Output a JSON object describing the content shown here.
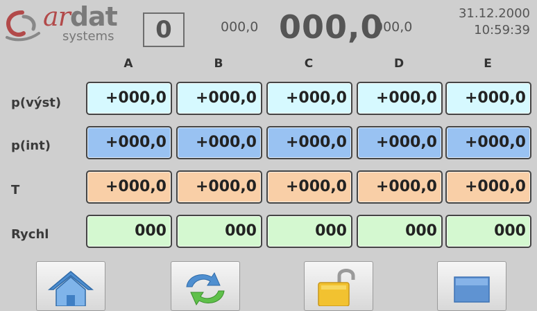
{
  "header": {
    "logo_brand": "ardat",
    "logo_sub": "systems",
    "counter": "0",
    "value_small_left": "000,0",
    "value_big": "000,0",
    "value_small_right": "000,0",
    "date": "31.12.2000",
    "time": "10:59:39"
  },
  "columns": [
    "A",
    "B",
    "C",
    "D",
    "E"
  ],
  "rows": [
    {
      "label": "p(výst)",
      "values": [
        "+000,0",
        "+000,0",
        "+000,0",
        "+000,0",
        "+000,0"
      ]
    },
    {
      "label": "p(int)",
      "values": [
        "+000,0",
        "+000,0",
        "+000,0",
        "+000,0",
        "+000,0"
      ]
    },
    {
      "label": "T",
      "values": [
        "+000,0",
        "+000,0",
        "+000,0",
        "+000,0",
        "+000,0"
      ]
    },
    {
      "label": "Rychl",
      "values": [
        "000",
        "000",
        "000",
        "000",
        "000"
      ]
    }
  ],
  "nav": {
    "icons": [
      "home-icon",
      "refresh-icon",
      "unlock-icon",
      "window-icon"
    ]
  },
  "colors": {
    "background": "#cfcfcf",
    "row_vyst": "#d6f9ff",
    "row_int": "#99c2f2",
    "row_t": "#f9cfa7",
    "row_rychl": "#d4f8d0"
  }
}
